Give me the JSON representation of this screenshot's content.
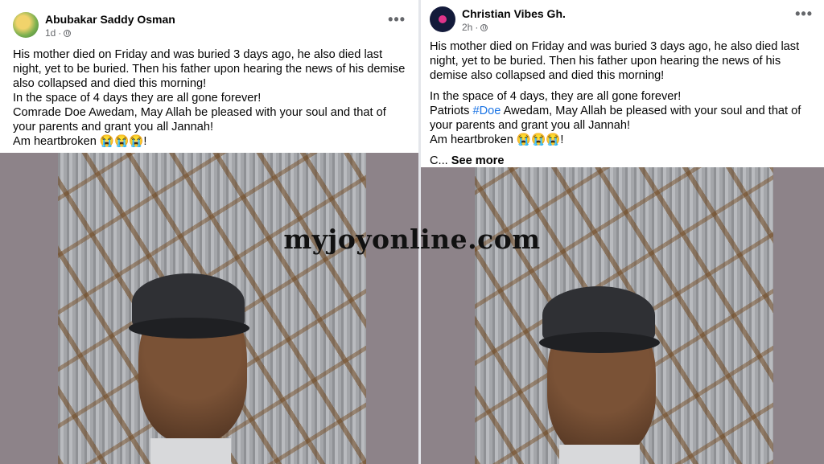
{
  "left_post": {
    "author": "Abubakar Saddy Osman",
    "time": "1d",
    "privacy_icon": "globe-icon",
    "more_icon": "more-options-icon",
    "paragraphs": [
      "His mother died on Friday and was buried 3 days ago, he also died last night, yet to be buried. Then his father upon hearing the news of his demise also collapsed and died this morning!",
      "In the space of 4 days they are all gone forever!",
      "Comrade Doe Awedam, May Allah be pleased with your soul and that of your parents and grant you all Jannah!",
      "Am heartbroken 😭😭😭!"
    ]
  },
  "right_post": {
    "author": "Christian Vibes Gh.",
    "time": "2h",
    "privacy_icon": "globe-icon",
    "more_icon": "more-options-icon",
    "paragraph1": "His mother died on Friday and was buried 3 days ago, he also died last night, yet to be buried. Then his father upon hearing the news of his demise also collapsed and died this morning!",
    "paragraph2": "In the space of 4 days, they are all gone forever!",
    "p3_before": "Patriots ",
    "p3_hashtag": "#Doe",
    "p3_after": " Awedam, May Allah be pleased with your soul and that of your parents and grant you all Jannah!",
    "paragraph4": "Am heartbroken 😭😭😭!",
    "truncated": "C... ",
    "see_more": "See more"
  },
  "watermark": "myjoyonline.com",
  "colors": {
    "link": "#1b74e4",
    "meta": "#65676b",
    "photo_border": "#8d8389"
  }
}
